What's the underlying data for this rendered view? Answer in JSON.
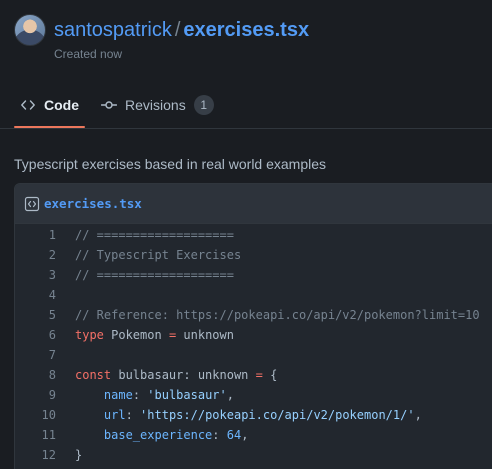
{
  "header": {
    "owner": "santospatrick",
    "separator": "/",
    "file_title": "exercises.tsx",
    "created_text": "Created now"
  },
  "tabs": [
    {
      "label": "Code",
      "icon": "code-icon",
      "selected": true
    },
    {
      "label": "Revisions",
      "icon": "git-commit-icon",
      "count": "1",
      "selected": false
    }
  ],
  "description": "Typescript exercises based in real world examples",
  "file": {
    "name": "exercises.tsx",
    "icon": "code-square-icon"
  },
  "code_lines": [
    {
      "n": "1",
      "segments": [
        {
          "t": "// ===================",
          "k": "com"
        }
      ]
    },
    {
      "n": "2",
      "segments": [
        {
          "t": "// Typescript Exercises",
          "k": "com"
        }
      ]
    },
    {
      "n": "3",
      "segments": [
        {
          "t": "// ===================",
          "k": "com"
        }
      ]
    },
    {
      "n": "4",
      "segments": []
    },
    {
      "n": "5",
      "segments": [
        {
          "t": "// Reference: https://pokeapi.co/api/v2/pokemon?limit=10",
          "k": "com"
        }
      ]
    },
    {
      "n": "6",
      "segments": [
        {
          "t": "type",
          "k": "kw"
        },
        {
          "t": " Pokemon ",
          "k": "txt"
        },
        {
          "t": "=",
          "k": "kw"
        },
        {
          "t": " unknown",
          "k": "txt"
        }
      ]
    },
    {
      "n": "7",
      "segments": []
    },
    {
      "n": "8",
      "segments": [
        {
          "t": "const",
          "k": "kw"
        },
        {
          "t": " bulbasaur: unknown ",
          "k": "txt"
        },
        {
          "t": "=",
          "k": "kw"
        },
        {
          "t": " {",
          "k": "txt"
        }
      ]
    },
    {
      "n": "9",
      "segments": [
        {
          "t": "    ",
          "k": "txt"
        },
        {
          "t": "name",
          "k": "prop"
        },
        {
          "t": ": ",
          "k": "txt"
        },
        {
          "t": "'bulbasaur'",
          "k": "str"
        },
        {
          "t": ",",
          "k": "txt"
        }
      ]
    },
    {
      "n": "10",
      "segments": [
        {
          "t": "    ",
          "k": "txt"
        },
        {
          "t": "url",
          "k": "prop"
        },
        {
          "t": ": ",
          "k": "txt"
        },
        {
          "t": "'https://pokeapi.co/api/v2/pokemon/1/'",
          "k": "str"
        },
        {
          "t": ",",
          "k": "txt"
        }
      ]
    },
    {
      "n": "11",
      "segments": [
        {
          "t": "    ",
          "k": "txt"
        },
        {
          "t": "base_experience",
          "k": "prop"
        },
        {
          "t": ": ",
          "k": "txt"
        },
        {
          "t": "64",
          "k": "num"
        },
        {
          "t": ",",
          "k": "txt"
        }
      ]
    },
    {
      "n": "12",
      "segments": [
        {
          "t": "}",
          "k": "txt"
        }
      ]
    }
  ],
  "colors": {
    "background": "#1a1d22",
    "link": "#539bf5",
    "selected_tab_underline": "#ec775c",
    "keyword": "#f47067",
    "string": "#96d0ff",
    "comment": "#768390"
  }
}
